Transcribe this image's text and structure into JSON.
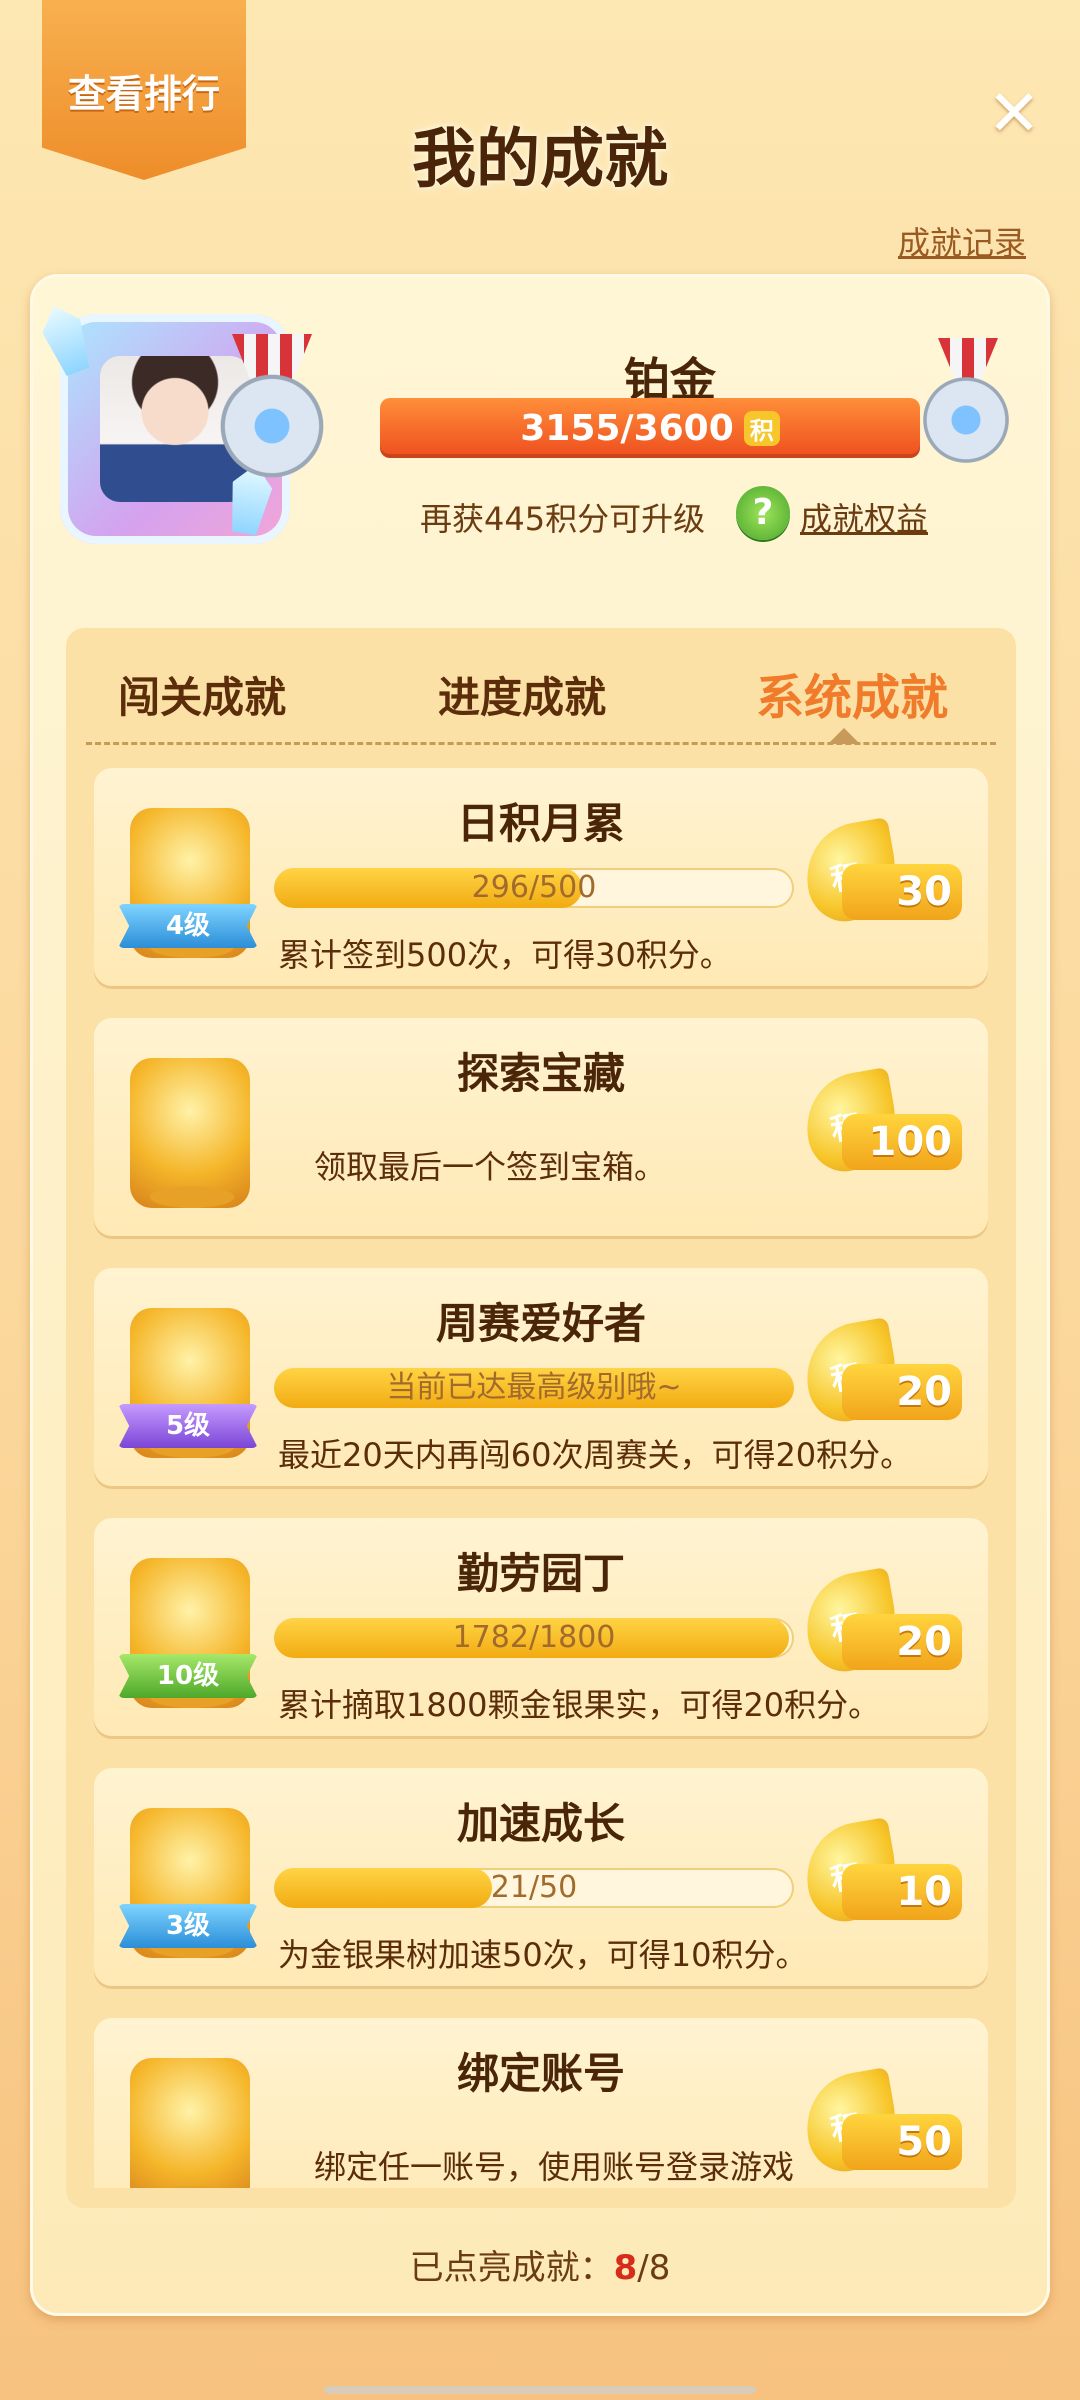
{
  "header": {
    "rank_button": "查看排行",
    "title": "我的成就",
    "close_symbol": "✕",
    "record_link": "成就记录"
  },
  "profile": {
    "rank_name": "铂金",
    "progress_text": "3155/3600",
    "points_glyph": "积",
    "progress_fraction": 0.876,
    "upgrade_hint": "再获445积分可升级",
    "benefits_icon_glyph": "?",
    "benefits_link": "成就权益"
  },
  "tabs": [
    {
      "label": "闯关成就",
      "active": false
    },
    {
      "label": "进度成就",
      "active": false
    },
    {
      "label": "系统成就",
      "active": true
    }
  ],
  "achievements": [
    {
      "title": "日积月累",
      "level": "4级",
      "level_color": "blue",
      "progress_text": "296/500",
      "progress": 0.592,
      "desc": "累计签到500次，可得30积分。",
      "points": "30",
      "icon": "calendar-trophy-icon"
    },
    {
      "title": "探索宝藏",
      "level": "",
      "level_color": "",
      "progress_text": "",
      "progress": null,
      "desc": "领取最后一个签到宝箱。",
      "points": "100",
      "icon": "treasure-chest-trophy-icon"
    },
    {
      "title": "周赛爱好者",
      "level": "5级",
      "level_color": "purple",
      "progress_text": "当前已达最高级别哦~",
      "progress": 1.0,
      "desc": "最近20天内再闯60次周赛关，可得20积分。",
      "points": "20",
      "icon": "fox-trophy-icon"
    },
    {
      "title": "勤劳园丁",
      "level": "10级",
      "level_color": "green",
      "progress_text": "1782/1800",
      "progress": 0.99,
      "desc": "累计摘取1800颗金银果实，可得20积分。",
      "points": "20",
      "icon": "watering-can-trophy-icon"
    },
    {
      "title": "加速成长",
      "level": "3级",
      "level_color": "blue",
      "progress_text": "21/50",
      "progress": 0.42,
      "desc": "为金银果树加速50次，可得10积分。",
      "points": "10",
      "icon": "hourglass-medal-icon"
    },
    {
      "title": "绑定账号",
      "level": "",
      "level_color": "",
      "progress_text": "",
      "progress": null,
      "desc": "绑定任一账号，使用账号登录游戏",
      "points": "50",
      "icon": "account-card-trophy-icon"
    }
  ],
  "points_glyph": "积",
  "footer": {
    "label": "已点亮成就：",
    "lit": "8",
    "separator": "/",
    "total": "8"
  }
}
